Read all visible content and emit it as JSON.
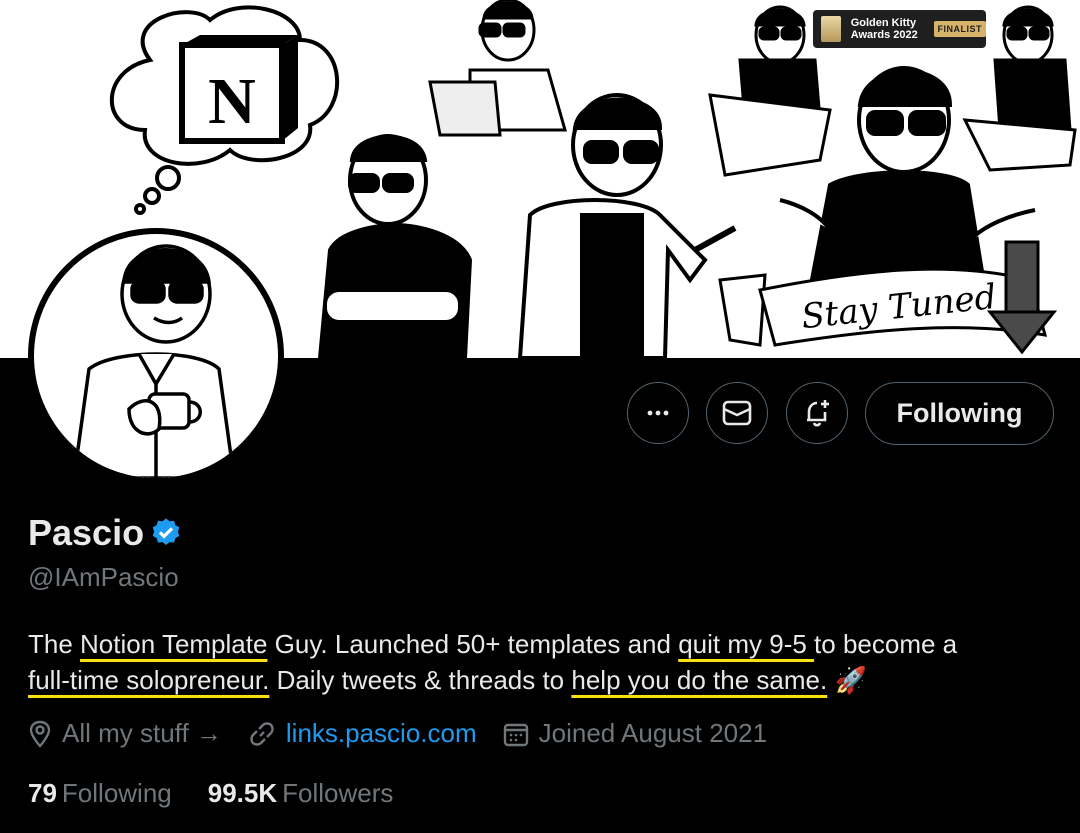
{
  "banner": {
    "award_line1": "Golden Kitty",
    "award_line2": "Awards 2022",
    "award_badge": "FINALIST",
    "banner_text": "Stay Tuned",
    "thought_logo": "N"
  },
  "actions": {
    "more_icon": "more-horizontal-icon",
    "message_icon": "envelope-icon",
    "notify_icon": "bell-plus-icon",
    "follow_label": "Following"
  },
  "profile": {
    "name": "Pascio",
    "verified": true,
    "verified_color": "#1d9bf0",
    "handle": "@IAmPascio",
    "bio": {
      "p1": "The ",
      "h1": "Notion Template",
      "p2": " Guy. Launched 50+ templates and ",
      "h2": "quit my 9-5 ",
      "p3": "to become a ",
      "h3": "full-time solopreneur.",
      "p4": " Daily tweets & threads to ",
      "h4": "help you do the same.",
      "emoji": "🚀"
    },
    "location": "All my stuff →",
    "website": "links.pascio.com",
    "joined": "Joined August 2021"
  },
  "stats": {
    "following_count": "79",
    "following_label": "Following",
    "followers_count": "99.5K",
    "followers_label": "Followers"
  },
  "colors": {
    "accent": "#1d9bf0",
    "highlight": "#f9e10e",
    "muted": "#71767b",
    "text": "#e7e9ea"
  }
}
